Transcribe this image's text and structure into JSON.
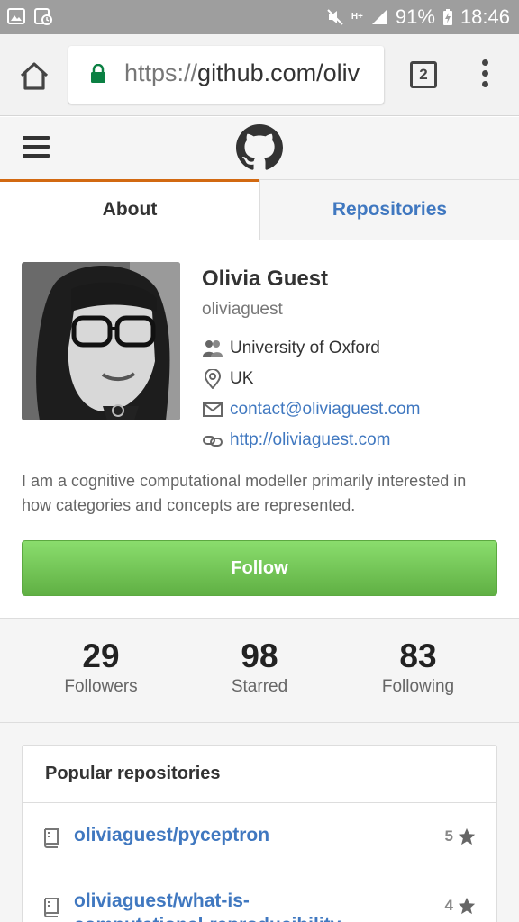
{
  "status_bar": {
    "icons_left": [
      "image-icon",
      "screenshot-icon"
    ],
    "icons_right": [
      "mute-icon",
      "hplus-icon",
      "signal-icon",
      "battery-charging-icon"
    ],
    "network": "H+",
    "battery": "91%",
    "time": "18:46"
  },
  "browser": {
    "url_scheme": "https://",
    "url_host": "github.com/oliv",
    "tab_count": "2"
  },
  "tabs": {
    "about": "About",
    "repositories": "Repositories"
  },
  "profile": {
    "name": "Olivia Guest",
    "username": "oliviaguest",
    "organization": "University of Oxford",
    "location": "UK",
    "email": "contact@oliviaguest.com",
    "website": "http://oliviaguest.com",
    "bio": "I am a cognitive computational modeller primarily interested in how categories and concepts are represented.",
    "follow_label": "Follow"
  },
  "stats": [
    {
      "value": "29",
      "label": "Followers"
    },
    {
      "value": "98",
      "label": "Starred"
    },
    {
      "value": "83",
      "label": "Following"
    }
  ],
  "popular": {
    "title": "Popular repositories",
    "repos": [
      {
        "name": "oliviaguest/pyceptron",
        "stars": "5"
      },
      {
        "name": "oliviaguest/what-is-computational-reproducibility",
        "stars": "4"
      }
    ]
  },
  "colors": {
    "accent_tab": "#d26911",
    "link": "#4078c0",
    "follow_green": "#60b044",
    "status_bar": "#9e9e9e"
  }
}
